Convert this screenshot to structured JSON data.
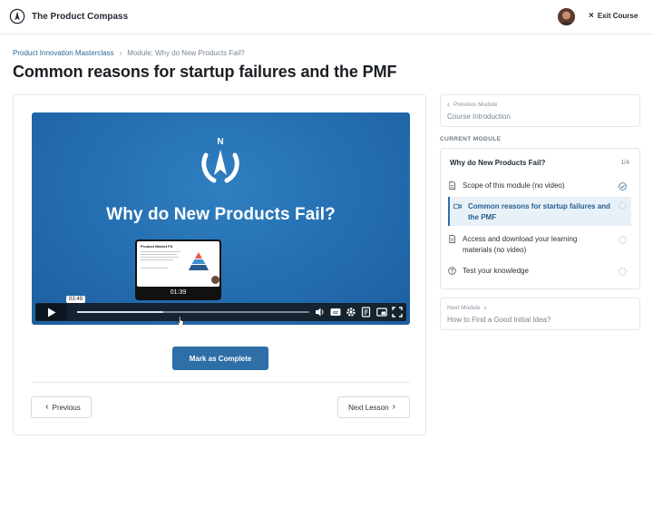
{
  "header": {
    "brand_name": "The Product Compass",
    "exit_label": "Exit Course"
  },
  "breadcrumb": {
    "course": "Product Innovation Masterclass",
    "module": "Module: Why do New Products Fail?"
  },
  "page_title": "Common reasons for startup failures and the PMF",
  "video": {
    "title": "Why do New Products Fail?",
    "thumbnail_title": "Product Market Fit",
    "thumbnail_time": "01:39",
    "hover_time": "03:49",
    "progress": 0.37
  },
  "actions": {
    "complete_label": "Mark as Complete",
    "previous_label": "Previous",
    "next_label": "Next Lesson"
  },
  "sidebar": {
    "previous_module": {
      "label": "Previous Module",
      "value": "Course Introduction"
    },
    "current_module_label": "CURRENT MODULE",
    "current_module": {
      "title": "Why do New Products Fail?",
      "count": "1/4",
      "lessons": [
        {
          "label": "Scope of this module (no video)",
          "icon": "document-icon",
          "status": "completed"
        },
        {
          "label": "Common reasons for startup failures and the PMF",
          "icon": "video-icon",
          "status": "current"
        },
        {
          "label": "Access and download your learning materials (no video)",
          "icon": "document-icon",
          "status": "not-started"
        },
        {
          "label": "Test your knowledge",
          "icon": "question-icon",
          "status": "not-started"
        }
      ]
    },
    "next_module": {
      "label": "Next Module",
      "value": "How to Find a Good Initial Idea?"
    }
  },
  "colors": {
    "accent": "#2d6fa6",
    "video_background": "#2570b3",
    "link": "#2b6a9a"
  }
}
